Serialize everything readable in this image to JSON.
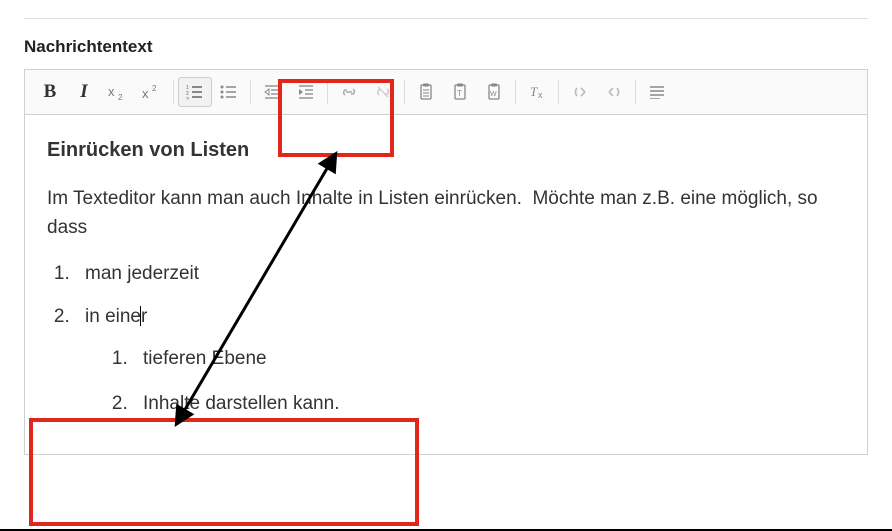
{
  "field_label": "Nachrichtentext",
  "toolbar": {
    "bold_label": "B",
    "italic_label": "I"
  },
  "document": {
    "heading": "Einrücken von Listen",
    "paragraph": "Im Texteditor kann man auch Inhalte in Listen einrücken.  Möchte man z.B. eine möglich, so dass",
    "list": {
      "item1": "man jederzeit",
      "item2_before": "in eine",
      "item2_after": "r",
      "sub1": "tieferen Ebene",
      "sub2": "Inhalte darstellen kann."
    }
  }
}
